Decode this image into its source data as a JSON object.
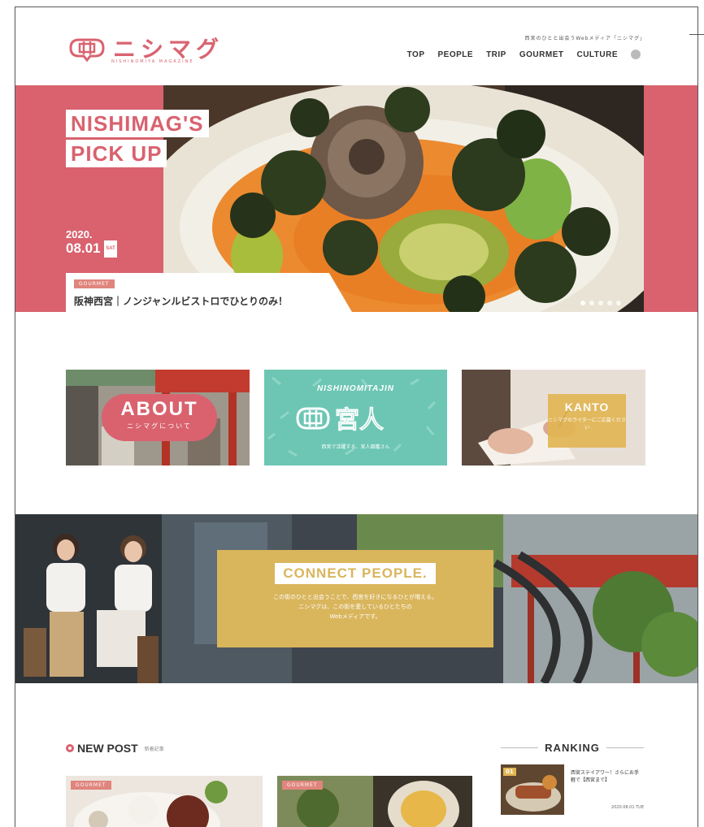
{
  "header": {
    "logo_text": "ニシマグ",
    "logo_sub": "NISHINOMIYA MAGAZINE",
    "tagline": "西宮のひとと出会うWebメディア「ニシマグ」",
    "nav": [
      "TOP",
      "PEOPLE",
      "TRIP",
      "GOURMET",
      "CULTURE"
    ]
  },
  "hero": {
    "pick_line1": "NISHIMAG'S",
    "pick_line2": "PICK UP",
    "year": "2020.",
    "day": "08.01",
    "dow": "SAT",
    "category": "GOURMET",
    "title": "阪神西宮｜ノンジャンルビストロでひとりのみ！",
    "dot_count": 5,
    "active_dot": 1
  },
  "banners": {
    "about_title": "ABOUT",
    "about_sub": "ニシマグについて",
    "nishinomiya_top": "NISHINOMITAJIN",
    "nishinomiya_logo": "宮人",
    "nishinomiya_sub": "西宮で活躍する、宮人図鑑さん",
    "kanto_title": "KANTO",
    "kanto_sub": "ニシマグのライターにご応募ください"
  },
  "connect": {
    "title": "CONNECT PEOPLE.",
    "lines": [
      "この街のひとと出会うことで、西宮を好きになるひとが増える。",
      "ニシマグは、この街を愛しているひとたちの",
      "Webメディアです。"
    ]
  },
  "bottom": {
    "newpost_title": "NEW POST",
    "newpost_sub": "新着記事",
    "post_categories": [
      "GOURMET",
      "GOURMET"
    ],
    "ranking_title": "RANKING",
    "rank_num": "01",
    "rank_text": "西宮ステイアワー！さらにお手軽で【西宮まで】",
    "rank_date": "2020.08.01 TUE"
  }
}
